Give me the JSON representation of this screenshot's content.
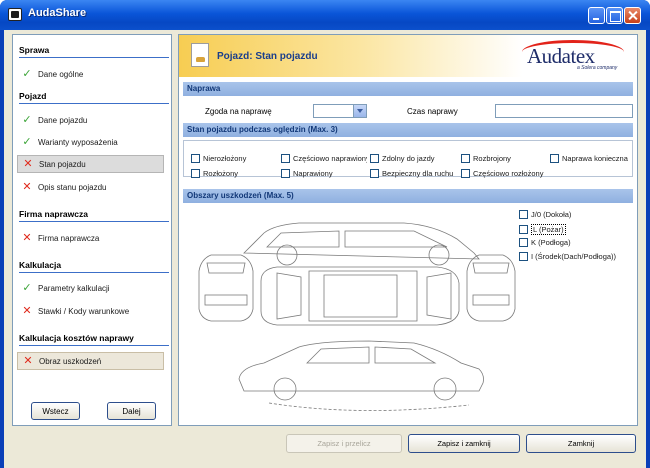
{
  "window": {
    "title": "AudaShare"
  },
  "sidebar": {
    "sections": [
      {
        "title": "Sprawa",
        "items": [
          {
            "label": "Dane ogólne",
            "status": "ok"
          }
        ]
      },
      {
        "title": "Pojazd",
        "items": [
          {
            "label": "Dane pojazdu",
            "status": "ok"
          },
          {
            "label": "Warianty wyposażenia",
            "status": "ok"
          },
          {
            "label": "Stan pojazdu",
            "status": "error",
            "selected": true
          },
          {
            "label": "Opis stanu pojazdu",
            "status": "error"
          }
        ]
      },
      {
        "title": "Firma naprawcza",
        "items": [
          {
            "label": "Firma naprawcza",
            "status": "error"
          }
        ]
      },
      {
        "title": "Kalkulacja",
        "items": [
          {
            "label": "Parametry kalkulacji",
            "status": "ok"
          },
          {
            "label": "Stawki / Kody warunkowe",
            "status": "error"
          }
        ]
      },
      {
        "title": "Kalkulacja kosztów naprawy",
        "items": [
          {
            "label": "Obraz uszkodzeń",
            "status": "error"
          }
        ]
      }
    ],
    "back_label": "Wstecz",
    "next_label": "Dalej"
  },
  "header": {
    "title": "Pojazd: Stan pojazdu",
    "logo_text": "Audatex",
    "logo_tagline": "a Solera company"
  },
  "naprawa": {
    "section_title": "Naprawa",
    "consent_label": "Zgoda na naprawę",
    "consent_value": "",
    "time_label": "Czas naprawy",
    "time_value": ""
  },
  "condition": {
    "section_title": "Stan pojazdu podczas oględzin (Max. 3)",
    "options": [
      "Nierozłożony",
      "Częściowo naprawiony",
      "Zdolny do jazdy",
      "Rozbrojony",
      "Naprawa konieczna",
      "Rozłożony",
      "Naprawiony",
      "Bezpieczny dla ruchu",
      "Częściowo rozłożony"
    ]
  },
  "damage": {
    "section_title": "Obszary uszkodzeń (Max. 5)",
    "options": [
      "J/0 (Dokoła)",
      "L (Pożar)",
      "K (Podłoga)",
      "I (Środek(Dach/Podłoga))"
    ]
  },
  "footer": {
    "save_next_label": "Zapisz i przelicz",
    "save_close_label": "Zapisz i zamknij",
    "cancel_label": "Zamknij"
  },
  "colors": {
    "title_bar": "#0a55d8",
    "section_bar": "#a9c4ea",
    "header_accent": "#f7cd52",
    "ok_icon": "#3ca438",
    "error_icon": "#e02a1c",
    "logo": "#1f2d6a"
  }
}
